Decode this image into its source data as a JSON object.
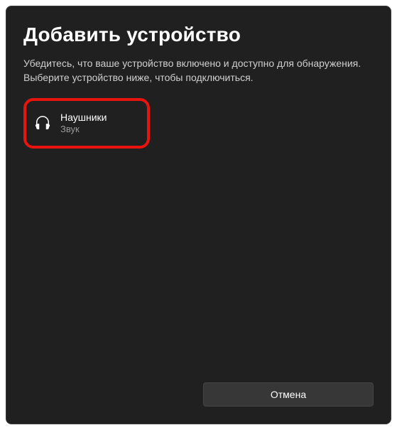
{
  "dialog": {
    "title": "Добавить устройство",
    "subtitle": "Убедитесь, что ваше устройство включено и доступно для обнаружения. Выберите устройство ниже, чтобы подключиться."
  },
  "devices": [
    {
      "name": "Наушники",
      "type": "Звук",
      "icon": "headphones"
    }
  ],
  "footer": {
    "cancel_label": "Отмена"
  }
}
